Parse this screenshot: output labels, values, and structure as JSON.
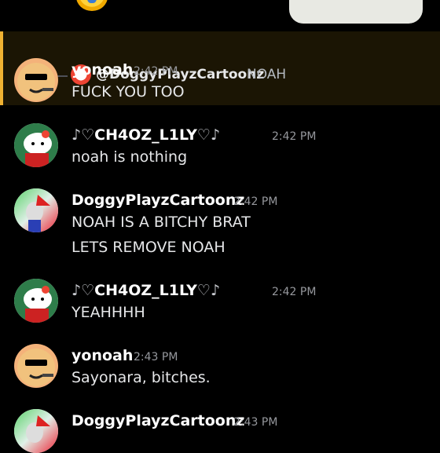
{
  "reply": {
    "author": "@DoggyPlayzCartoonz",
    "text": "NOAH"
  },
  "messages": [
    {
      "author": "yonoah",
      "time": "2:42 PM",
      "lines": [
        "FUCK YOU TOO"
      ],
      "avatar_icon": "sunglasses-face-icon",
      "highlighted": true
    },
    {
      "author": "CH4OZ_L1LY",
      "author_prefix": "♪♡",
      "author_suffix": "♡♪",
      "time": "2:42 PM",
      "lines": [
        "noah is nothing"
      ],
      "avatar_icon": "hello-kitty-icon"
    },
    {
      "author": "DoggyPlayzCartoonz",
      "time": "2:42 PM",
      "lines": [
        "NOAH IS A BITCHY BRAT",
        "LETS REMOVE NOAH"
      ],
      "avatar_icon": "christmas-character-icon"
    },
    {
      "author": "CH4OZ_L1LY",
      "author_prefix": "♪♡",
      "author_suffix": "♡♪",
      "time": "2:42 PM",
      "lines": [
        "YEAHHHH"
      ],
      "avatar_icon": "hello-kitty-icon"
    },
    {
      "author": "yonoah",
      "time": "2:43 PM",
      "lines": [
        "Sayonara, bitches."
      ],
      "avatar_icon": "sunglasses-face-icon"
    },
    {
      "author": "DoggyPlayzCartoonz",
      "time": "2:43 PM",
      "lines": [],
      "avatar_icon": "christmas-character-icon"
    }
  ],
  "colors": {
    "highlight_bar": "#f0b232",
    "highlight_bg": "#1b1504",
    "timestamp": "#96989d"
  }
}
